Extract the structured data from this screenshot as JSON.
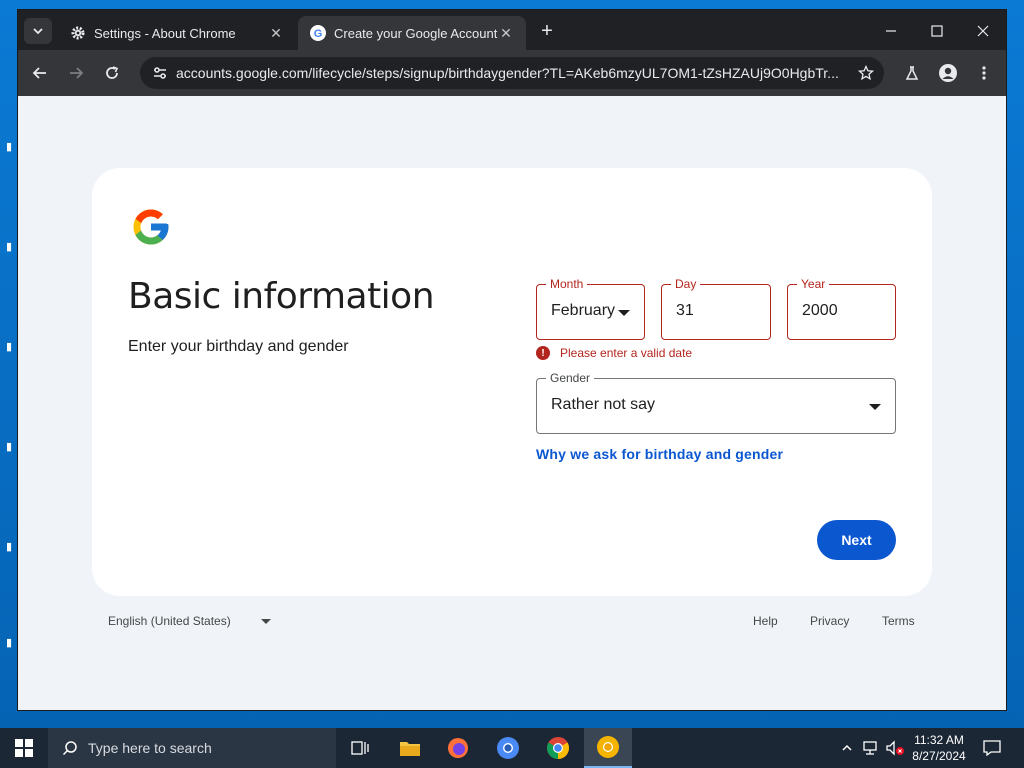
{
  "browser": {
    "tabs": [
      {
        "title": "Settings - About Chrome",
        "icon": "gear-icon",
        "active": false
      },
      {
        "title": "Create your Google Account",
        "icon": "google-g-icon",
        "active": true
      }
    ],
    "url": "accounts.google.com/lifecycle/steps/signup/birthdaygender?TL=AKeb6mzyUL7OM1-tZsHZAUj9O0HgbTr..."
  },
  "page": {
    "heading": "Basic information",
    "subheading": "Enter your birthday and gender",
    "month": {
      "label": "Month",
      "value": "February"
    },
    "day": {
      "label": "Day",
      "value": "31"
    },
    "year": {
      "label": "Year",
      "value": "2000"
    },
    "error_message": "Please enter a valid date",
    "gender": {
      "label": "Gender",
      "value": "Rather not say"
    },
    "why_link": "Why we ask for birthday and gender",
    "next_label": "Next"
  },
  "footer": {
    "language": "English (United States)",
    "help": "Help",
    "privacy": "Privacy",
    "terms": "Terms"
  },
  "taskbar": {
    "search_placeholder": "Type here to search",
    "time": "11:32 AM",
    "date": "8/27/2024"
  },
  "colors": {
    "error": "#b3261e",
    "link": "#0b57d0",
    "page_bg": "#f0f4f9",
    "button": "#0b57d0"
  }
}
